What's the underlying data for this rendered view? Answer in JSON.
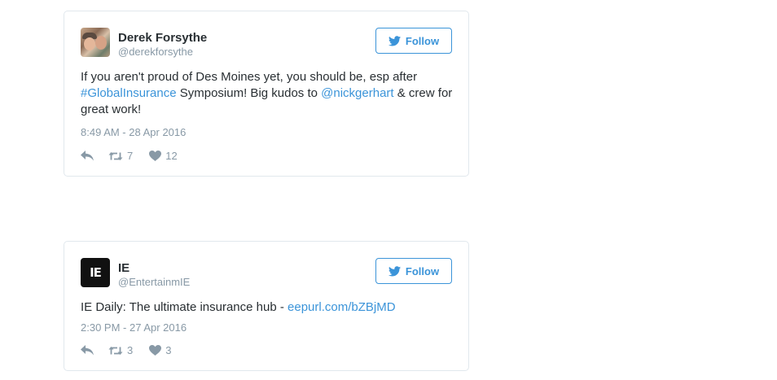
{
  "tweets": [
    {
      "display_name": "Derek Forsythe",
      "screen_name": "@derekforsythe",
      "follow_label": "Follow",
      "text": {
        "part1": "If you aren't proud of Des Moines yet, you should be, esp after ",
        "hashtag": "#GlobalInsurance",
        "part2": " Symposium! Big kudos to ",
        "mention": "@nickgerhart",
        "part3": " & crew for great work!"
      },
      "timestamp": "8:49 AM - 28 Apr 2016",
      "retweets": "7",
      "likes": "12"
    },
    {
      "display_name": "IE",
      "screen_name": "@EntertainmIE",
      "avatar_text": "IE",
      "follow_label": "Follow",
      "text": {
        "part1": "IE Daily: The ultimate insurance hub - ",
        "link": "eepurl.com/bZBjMD"
      },
      "timestamp": "2:30 PM - 27 Apr 2016",
      "retweets": "3",
      "likes": "3"
    }
  ],
  "icons": {
    "reply": "reply-icon",
    "retweet": "retweet-icon",
    "like": "heart-icon",
    "follow": "twitter-bird-icon"
  },
  "colors": {
    "accent": "#3b94d9",
    "muted": "#8899a6",
    "text": "#292f33",
    "border": "#e1e8ed"
  }
}
